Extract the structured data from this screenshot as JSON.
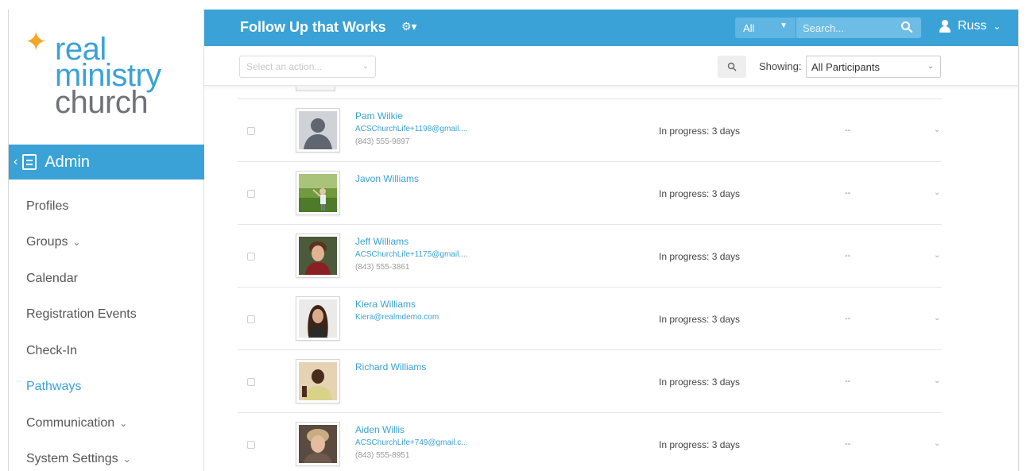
{
  "logo": {
    "line1": "real",
    "line2": "ministry",
    "line3": "church"
  },
  "sidebar": {
    "section_label": "Admin",
    "items": [
      {
        "label": "Profiles",
        "caret": ""
      },
      {
        "label": "Groups",
        "caret": "⌄"
      },
      {
        "label": "Calendar",
        "caret": ""
      },
      {
        "label": "Registration Events",
        "caret": ""
      },
      {
        "label": "Check-In",
        "caret": ""
      },
      {
        "label": "Pathways",
        "caret": "",
        "active": true
      },
      {
        "label": "Communication",
        "caret": "⌄"
      },
      {
        "label": "System Settings",
        "caret": "⌄"
      }
    ]
  },
  "header": {
    "title": "Follow Up that Works",
    "scope_value": "All",
    "search_placeholder": "Search...",
    "user_name": "Russ"
  },
  "toolbar": {
    "action_placeholder": "Select an action...",
    "showing_label": "Showing:",
    "showing_value": "All Participants"
  },
  "rows": [
    {
      "name": "Pam Wilkie",
      "email": "ACSChurchLife+1198@gmail....",
      "phone": "(843) 555-9897",
      "status": "In progress: 3 days",
      "due": "--",
      "photo": "default-avatar"
    },
    {
      "name": "Javon Williams",
      "email": "",
      "phone": "",
      "status": "In progress: 3 days",
      "due": "--",
      "photo": "child-outdoors"
    },
    {
      "name": "Jeff Williams",
      "email": "ACSChurchLife+1175@gmail....",
      "phone": "(843) 555-3861",
      "status": "In progress: 3 days",
      "due": "--",
      "photo": "young-man"
    },
    {
      "name": "Kiera Williams",
      "email": "Kiera@realmdemo.com",
      "phone": "",
      "status": "In progress: 3 days",
      "due": "--",
      "photo": "young-woman"
    },
    {
      "name": "Richard Williams",
      "email": "",
      "phone": "",
      "status": "In progress: 3 days",
      "due": "--",
      "photo": "smiling-man"
    },
    {
      "name": "Aiden Willis",
      "email": "ACSChurchLife+749@gmail.c...",
      "phone": "(843) 555-8951",
      "status": "In progress: 3 days",
      "due": "--",
      "photo": "blond-teen"
    }
  ],
  "colors": {
    "brand_blue": "#3aa2d6",
    "logo_gray": "#6f7278",
    "star_orange": "#f5a623"
  }
}
